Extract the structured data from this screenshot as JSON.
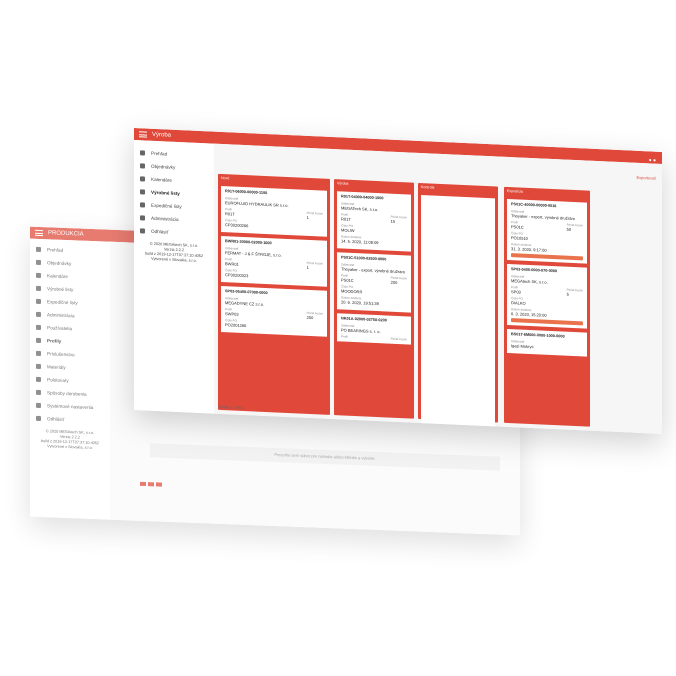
{
  "front": {
    "app_title": "Výroba",
    "nav": [
      {
        "label": "Prehľad",
        "icon": "grid-icon"
      },
      {
        "label": "Objednávky",
        "icon": "orders-icon"
      },
      {
        "label": "Kalendáre",
        "icon": "calendar-icon"
      },
      {
        "label": "Výrobné listy",
        "icon": "wrench-icon"
      },
      {
        "label": "Expedičné listy",
        "icon": "truck-icon"
      },
      {
        "label": "Administrácia",
        "icon": "gear-icon"
      },
      {
        "label": "Odhlásiť",
        "icon": "power-icon"
      }
    ],
    "version": [
      "© 2020 MEGAtech SK, s.r.o.",
      "Verzia 2.2.2",
      "build z 2019-12-17T07:37:10.4052",
      "Vytvorené v Slovakia, s.r.o."
    ],
    "columns": [
      {
        "title": "Nové",
        "cards": [
          {
            "code": "R01T-06000-00000-1100",
            "customer_label": "Odberateľ",
            "customer": "EUROFLUID HYDRAULIK SR s.r.o.",
            "profile_label": "Profil",
            "profile": "R01T",
            "count_label": "Počet kusov",
            "count": "1",
            "po_label": "Číslo PO",
            "po": "CP30200266"
          },
          {
            "code": "BWR01-30000-02000-1000",
            "customer_label": "Odberateľ",
            "customer": "FERMAT - J & F ŠTROJE, s.r.o.",
            "profile_label": "Profil",
            "profile": "BWR01",
            "count_label": "Počet kusov",
            "count": "1",
            "po_label": "Číslo PO",
            "po": "CP30200323"
          },
          {
            "code": "SP03-05400-07000-0000",
            "customer_label": "Odberateľ",
            "customer": "MEGADYNE CZ s.r.o.",
            "profile_label": "Profil",
            "profile": "SWP03",
            "count_label": "Počet kusov",
            "count": "250",
            "po_label": "Číslo PO",
            "po": "PO2001266"
          }
        ]
      },
      {
        "title": "Výroba",
        "cards": [
          {
            "code": "R01T-04000-04000-1000",
            "customer_label": "Odberateľ",
            "customer": "MEGATech SK, s.r.o.",
            "profile_label": "Profil",
            "profile": "R01T",
            "count_label": "Počet kusov",
            "count": "15",
            "po_label": "Číslo PO",
            "po": "MOLIW",
            "date_label": "Dátum dodania",
            "date": "14. 5. 2020, 11:08:09"
          },
          {
            "code": "PS01C-51000-02500-0000",
            "customer_label": "Odberateľ",
            "customer": "Thoyaker - export, výrobné družstvo",
            "profile_label": "Profil",
            "profile": "PS01C",
            "count_label": "Počet kusov",
            "count": "200",
            "po_label": "Číslo PO",
            "po": "MOODORR",
            "date_label": "Dátum dodania",
            "date": "20. 6. 2020, 19:51:39"
          },
          {
            "code": "NK01A-02000-02750-0200",
            "customer_label": "Odberateľ",
            "customer": "PO BEARINGS s. r. o.",
            "profile_label": "Profil",
            "profile": "",
            "count_label": "Počet kusov",
            "count": ""
          }
        ]
      },
      {
        "title": "Kontrola",
        "cards": []
      },
      {
        "title": "Expedícia",
        "cards": [
          {
            "code": "PS01C-40000-00000-0016",
            "customer_label": "Odberateľ",
            "customer": "Thoyaker - export, výrobné družstvo",
            "profile_label": "Profil",
            "profile": "PS01C",
            "count_label": "Počet kusov",
            "count": "50",
            "po_label": "Číslo PO",
            "po": "PO10510",
            "date_label": "Dátum dodania",
            "date": "31. 3. 2020, 9:17:00"
          },
          {
            "code": "SP03-0400-0000-070-0000",
            "customer_label": "Odberateľ",
            "customer": "MEGAtech SK, s.r.o.",
            "profile_label": "Profil",
            "profile": "SP03",
            "count_label": "Počet kusov",
            "count": "5",
            "po_label": "Číslo PO",
            "po": "DIALKO",
            "date_label": "Dátum dodania",
            "date": "6. 3. 2020, 15:20:00"
          },
          {
            "code": "BS01T-6M000-0000-1000-0000",
            "customer_label": "Odberateľ",
            "customer": "Igazi Mokrys",
            "profile_label": "",
            "profile": "",
            "count_label": "",
            "count": ""
          }
        ]
      }
    ],
    "action_label": "Exportovať",
    "status": "Skryté z menu"
  },
  "back": {
    "app_title": "PRODUKCIA",
    "nav": [
      {
        "label": "Prehľad",
        "icon": "grid-icon"
      },
      {
        "label": "Objednávky",
        "icon": "orders-icon"
      },
      {
        "label": "Kalendáre",
        "icon": "calendar-icon"
      },
      {
        "label": "Výrobné listy",
        "icon": "wrench-icon"
      },
      {
        "label": "Expedičné listy",
        "icon": "truck-icon"
      },
      {
        "label": "Administrácia",
        "icon": "gear-icon"
      },
      {
        "label": "Používatelia",
        "icon": "users-icon"
      },
      {
        "label": "Profily",
        "icon": "profile-icon"
      },
      {
        "label": "Príslušenstvo",
        "icon": "parts-icon"
      },
      {
        "label": "Materiály",
        "icon": "material-icon"
      },
      {
        "label": "Polotovary",
        "icon": "semi-icon"
      },
      {
        "label": "Spôsoby dorobenia",
        "icon": "finish-icon"
      },
      {
        "label": "Systémové nastavenia",
        "icon": "settings-icon"
      },
      {
        "label": "Odhlásiť",
        "icon": "power-icon"
      }
    ],
    "version": [
      "© 2020 MEGAtech SK, s.r.o.",
      "Verzia 2.2.2",
      "build z 2019-12-17T07:37:10.4052",
      "Vytvorené v Slovakia, s.r.o."
    ],
    "hint": "Presuňte sem súbor pre nahratie alebo kliknite a vyberte."
  }
}
